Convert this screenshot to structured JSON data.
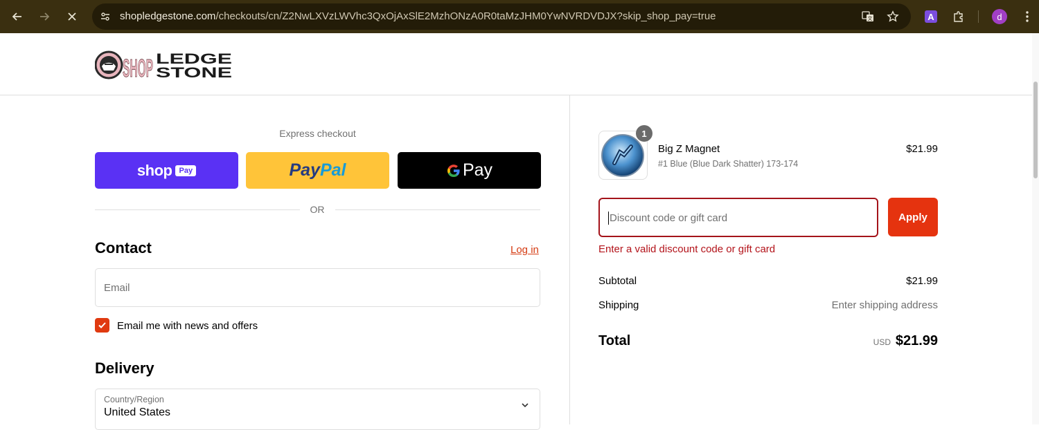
{
  "browser": {
    "url_host": "shopledgestone.com",
    "url_path": "/checkouts/cn/Z2NwLXVzLWVhc3QxOjAxSlE2MzhONzA0R0taMzJHM0YwNVRDVDJX?skip_shop_pay=true",
    "profile_initial": "d",
    "extension_letter": "A"
  },
  "header": {
    "logo_text_shop": "SHOP",
    "logo_text_ledge": "LEDGE",
    "logo_text_stone": "STONE"
  },
  "express": {
    "title": "Express checkout",
    "shop_word": "shop",
    "shop_tag": "Pay",
    "paypal_a": "Pay",
    "paypal_b": "Pal",
    "gpay": "Pay",
    "or": "OR"
  },
  "contact": {
    "title": "Contact",
    "login": "Log in",
    "email_placeholder": "Email",
    "newsletter_label": "Email me with news and offers"
  },
  "delivery": {
    "title": "Delivery",
    "country_label": "Country/Region",
    "country_value": "United States"
  },
  "summary": {
    "item": {
      "quantity": "1",
      "name": "Big Z Magnet",
      "variant": "#1 Blue (Blue Dark Shatter) 173-174",
      "price": "$21.99"
    },
    "discount_placeholder": "Discount code or gift card",
    "apply_label": "Apply",
    "discount_error": "Enter a valid discount code or gift card",
    "subtotal_label": "Subtotal",
    "subtotal_value": "$21.99",
    "shipping_label": "Shipping",
    "shipping_value": "Enter shipping address",
    "total_label": "Total",
    "total_currency": "USD",
    "total_value": "$21.99"
  },
  "colors": {
    "accent": "#e5330f",
    "error": "#b3131a",
    "shop_pay": "#5a31f4",
    "paypal": "#ffc439"
  }
}
